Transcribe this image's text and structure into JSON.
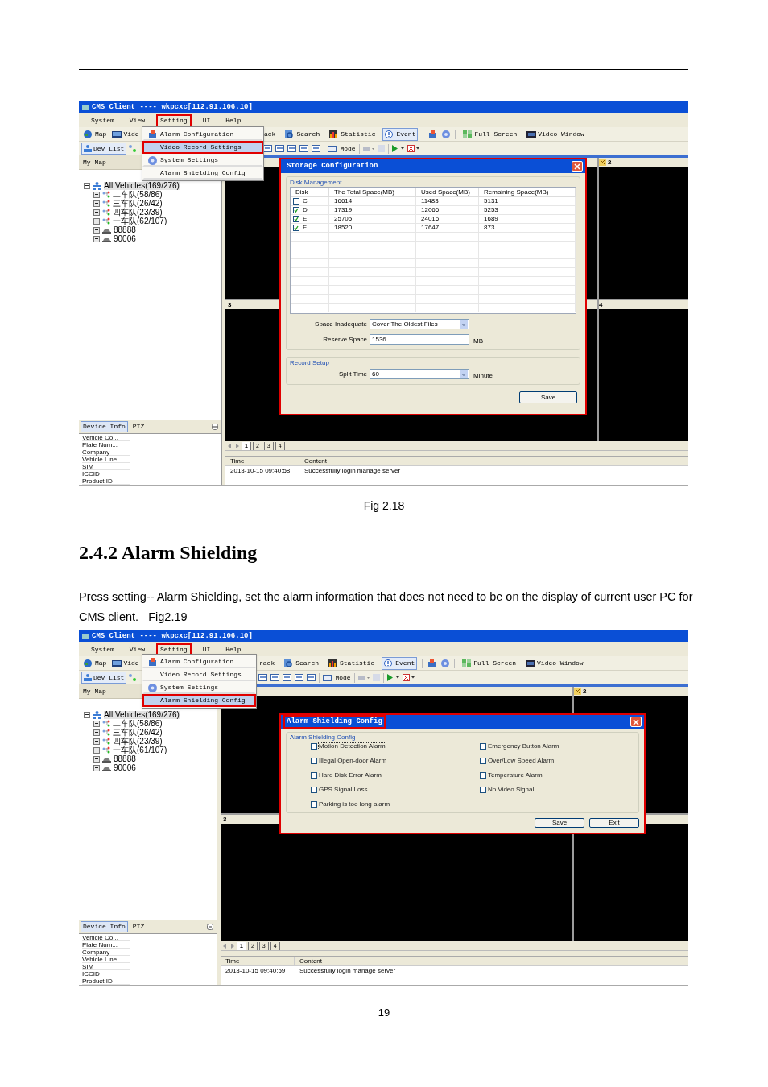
{
  "figure_1": {
    "window": {
      "title": "CMS Client ---- wkpcxc[112.91.106.10]"
    },
    "menu_bar": [
      {
        "label": "System",
        "selected": false
      },
      {
        "label": "View",
        "selected": false
      },
      {
        "label": "Setting",
        "selected": true
      },
      {
        "label": "UI",
        "selected": false
      },
      {
        "label": "Help",
        "selected": false
      }
    ],
    "setting_menu": [
      {
        "label": "Alarm Configuration",
        "selected": false
      },
      {
        "label": "Video Record Settings",
        "selected": true
      },
      {
        "label": "System Settings",
        "selected": false
      },
      {
        "label": "Alarm Shielding Config",
        "selected": false
      }
    ],
    "toolbar_1": [
      {
        "label": "Map",
        "selected": false
      },
      {
        "label": "Vide",
        "selected": false
      },
      {
        "label": "ack",
        "selected": false
      },
      {
        "label": "Search",
        "selected": false
      },
      {
        "label": "Statistic",
        "selected": false
      },
      {
        "label": "Event",
        "selected": true
      },
      {
        "label": "Full Screen",
        "selected": false
      },
      {
        "label": "Video Window",
        "selected": false
      }
    ],
    "toolbar_2": {
      "dev_list": {
        "label": "Dev List",
        "selected": true
      },
      "mode_label": "Mode"
    },
    "left_panel": {
      "header": "My Map",
      "tree": {
        "label": "All Vehicles(169/276)",
        "kind": "root",
        "expanded": true,
        "selected": true,
        "children": [
          {
            "label": "二车队(58/86)",
            "kind": "group",
            "expanded": false,
            "selected": false
          },
          {
            "label": "三车队(26/42)",
            "kind": "group",
            "expanded": false,
            "selected": false
          },
          {
            "label": "四车队(23/39)",
            "kind": "group",
            "expanded": false,
            "selected": false
          },
          {
            "label": "一车队(62/107)",
            "kind": "group",
            "expanded": false,
            "selected": false
          },
          {
            "label": "88888",
            "kind": "vehicle",
            "expanded": false,
            "selected": false
          },
          {
            "label": "90006",
            "kind": "vehicle",
            "expanded": false,
            "selected": false
          }
        ]
      },
      "info_tabs": [
        {
          "label": "Device Info",
          "selected": true
        },
        {
          "label": "PTZ",
          "selected": false
        }
      ],
      "info_rows": [
        "Vehicle Co...",
        "Plate Num...",
        "Company",
        "Vehicle Line",
        "SIM",
        "ICCID",
        "Product ID"
      ]
    },
    "video": {
      "cells": [
        {
          "label": "2"
        },
        {
          "label": "3"
        },
        {
          "label": "4"
        }
      ],
      "page_tabs": [
        {
          "label": "1",
          "selected": true
        },
        {
          "label": "2",
          "selected": false
        },
        {
          "label": "3",
          "selected": false
        },
        {
          "label": "4",
          "selected": false
        }
      ]
    },
    "log": {
      "columns": [
        "Time",
        "Content"
      ],
      "rows": [
        [
          "2013-10-15 09:40:58",
          "Successfully login manage server"
        ]
      ]
    },
    "dialog": {
      "kind": "storage",
      "title": "Storage Configuration",
      "title_highlighted": false,
      "disk_group": "Disk Management",
      "columns": [
        "Disk",
        "The Total Space(MB)",
        "Used Space(MB)",
        "Remaining Space(MB)"
      ],
      "rows": [
        {
          "disk": "C",
          "checked": false,
          "total": "16614",
          "used": "11483",
          "remaining": "5131"
        },
        {
          "disk": "D",
          "checked": true,
          "total": "17319",
          "used": "12066",
          "remaining": "5253"
        },
        {
          "disk": "E",
          "checked": true,
          "total": "25705",
          "used": "24016",
          "remaining": "1689"
        },
        {
          "disk": "F",
          "checked": true,
          "total": "18520",
          "used": "17647",
          "remaining": "873"
        }
      ],
      "space_inadequate": {
        "label": "Space Inadequate",
        "value": "Cover The Oldest Files"
      },
      "reserve_space": {
        "label": "Reserve Space",
        "value": "1536",
        "unit": "MB"
      },
      "record_group": "Record Setup",
      "split_time": {
        "label": "Split Time",
        "value": "60",
        "unit": "Minute"
      },
      "buttons": [
        "Save"
      ]
    }
  },
  "caption": "Fig 2.18",
  "section_heading": "2.4.2 Alarm Shielding",
  "body_text": "Press setting-- Alarm Shielding, set the alarm information that does not need to be on the display of current user PC for CMS client.   Fig2.19",
  "figure_2": {
    "window": {
      "title": "CMS Client ---- wkpcxc[112.91.106.10]"
    },
    "menu_bar": [
      {
        "label": "System",
        "selected": false
      },
      {
        "label": "View",
        "selected": false
      },
      {
        "label": "Setting",
        "selected": true
      },
      {
        "label": "UI",
        "selected": false
      },
      {
        "label": "Help",
        "selected": false
      }
    ],
    "setting_menu": [
      {
        "label": "Alarm Configuration",
        "selected": false
      },
      {
        "label": "Video Record Settings",
        "selected": false
      },
      {
        "label": "System Settings",
        "selected": false
      },
      {
        "label": "Alarm Shielding Config",
        "selected": true
      }
    ],
    "toolbar_1": [
      {
        "label": "Map",
        "selected": false
      },
      {
        "label": "Vide",
        "selected": false
      },
      {
        "label": "rack",
        "selected": false
      },
      {
        "label": "Search",
        "selected": false
      },
      {
        "label": "Statistic",
        "selected": false
      },
      {
        "label": "Event",
        "selected": true
      },
      {
        "label": "Full Screen",
        "selected": false
      },
      {
        "label": "Video Window",
        "selected": false
      }
    ],
    "toolbar_2": {
      "dev_list": {
        "label": "Dev List",
        "selected": true
      },
      "mode_label": "Mode"
    },
    "left_panel": {
      "header": "My Map",
      "tree": {
        "label": "All Vehicles(169/276)",
        "kind": "root",
        "expanded": true,
        "selected": true,
        "children": [
          {
            "label": "二车队(58/86)",
            "kind": "group",
            "expanded": false,
            "selected": false
          },
          {
            "label": "三车队(26/42)",
            "kind": "group",
            "expanded": false,
            "selected": false
          },
          {
            "label": "四车队(23/39)",
            "kind": "group",
            "expanded": false,
            "selected": false
          },
          {
            "label": "一车队(61/107)",
            "kind": "group",
            "expanded": false,
            "selected": false
          },
          {
            "label": "88888",
            "kind": "vehicle",
            "expanded": false,
            "selected": false
          },
          {
            "label": "90006",
            "kind": "vehicle",
            "expanded": false,
            "selected": false
          }
        ]
      },
      "info_tabs": [
        {
          "label": "Device Info",
          "selected": true
        },
        {
          "label": "PTZ",
          "selected": false
        }
      ],
      "info_rows": [
        "Vehicle Co...",
        "Plate Num...",
        "Company",
        "Vehicle Line",
        "SIM",
        "ICCID",
        "Product ID"
      ]
    },
    "video": {
      "cells": [
        {
          "label": "2"
        },
        {
          "label": "3"
        }
      ],
      "page_tabs": [
        {
          "label": "1",
          "selected": true
        },
        {
          "label": "2",
          "selected": false
        },
        {
          "label": "3",
          "selected": false
        },
        {
          "label": "4",
          "selected": false
        }
      ]
    },
    "log": {
      "columns": [
        "Time",
        "Content"
      ],
      "rows": [
        [
          "2013-10-15 09:40:59",
          "Successfully login manage server"
        ]
      ]
    },
    "dialog": {
      "kind": "alarm",
      "title": "Alarm Shielding Config",
      "title_highlighted": true,
      "group": "Alarm Shielding Config",
      "options": [
        {
          "label": "Motion Detection Alarm",
          "checked": false,
          "focused": true
        },
        {
          "label": "Illegal Open-door Alarm",
          "checked": false,
          "focused": false
        },
        {
          "label": "Hard Disk Error Alarm",
          "checked": false,
          "focused": false
        },
        {
          "label": "GPS Signal Loss",
          "checked": false,
          "focused": false
        },
        {
          "label": "Parking is too long alarm",
          "checked": false,
          "focused": false
        },
        {
          "label": "Emergency Button Alarm",
          "checked": false,
          "focused": false
        },
        {
          "label": "Over/Low Speed Alarm",
          "checked": false,
          "focused": false
        },
        {
          "label": "Temperature Alarm",
          "checked": false,
          "focused": false
        },
        {
          "label": "No Video Signal",
          "checked": false,
          "focused": false
        }
      ],
      "buttons": [
        "Save",
        "Exit"
      ]
    }
  },
  "page_number": "19"
}
